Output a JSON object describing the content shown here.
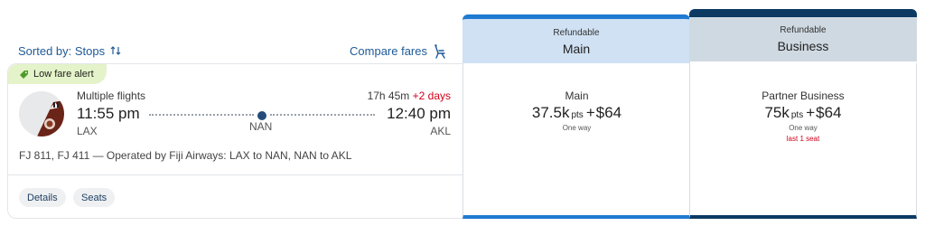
{
  "toolbar": {
    "sort_label": "Sorted by: Stops",
    "compare_label": "Compare fares"
  },
  "flight": {
    "alert_label": "Low fare alert",
    "type_label": "Multiple flights",
    "duration": "17h 45m",
    "plus_days": "+2 days",
    "depart_time": "11:55 pm",
    "arrive_time": "12:40 pm",
    "origin": "LAX",
    "stop": "NAN",
    "destination": "AKL",
    "operated_by": "FJ 811, FJ 411 — Operated by Fiji Airways: LAX to NAN, NAN to AKL",
    "details_label": "Details",
    "seats_label": "Seats"
  },
  "fares": {
    "main": {
      "refund_label": "Refundable",
      "cabin": "Main",
      "product": "Main",
      "points": "37.5k",
      "pts_unit": "pts",
      "plus": "+",
      "cash": "$64",
      "trip": "One way"
    },
    "business": {
      "refund_label": "Refundable",
      "cabin": "Business",
      "product": "Partner Business",
      "points": "75k",
      "pts_unit": "pts",
      "plus": "+",
      "cash": "$64",
      "trip": "One way",
      "warning": "last 1 seat"
    }
  },
  "colors": {
    "link": "#1e5a96",
    "main_accent": "#1f7ad1",
    "business_accent": "#0c3a63",
    "alert_bg": "#e4f3c9",
    "warning": "#d0021b"
  },
  "icons": {
    "sort": "sort-arrows-icon",
    "compare": "seat-icon",
    "alert": "price-tag-icon",
    "airline": "fiji-airways-tail-logo"
  }
}
